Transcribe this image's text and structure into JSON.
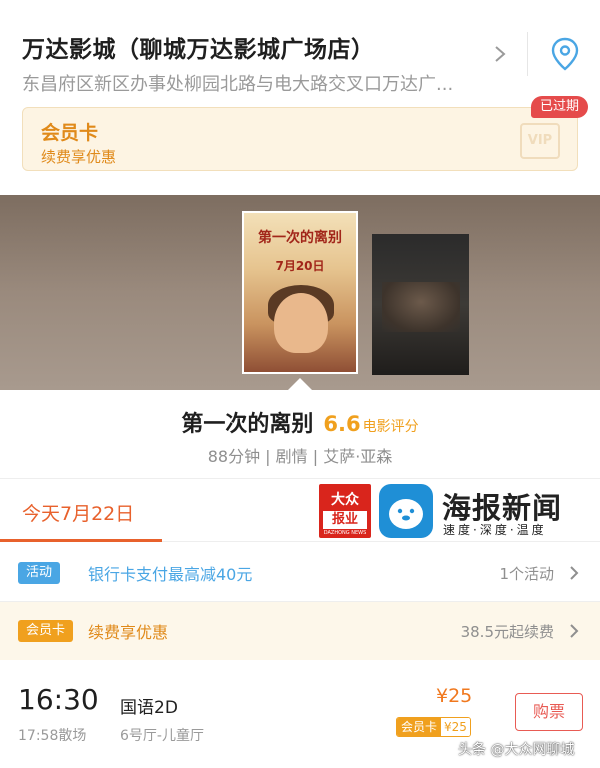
{
  "header": {
    "cinema_name": "万达影城（聊城万达影城广场店）",
    "address": "东昌府区新区办事处柳园北路与电大路交叉口万达广..."
  },
  "member_card": {
    "title": "会员卡",
    "subtitle": "续费享优惠",
    "vip_text": "VIP",
    "expired_badge": "已过期"
  },
  "movie": {
    "title": "第一次的离别",
    "rating": "6.6",
    "rating_label": "电影评分",
    "meta": "88分钟 | 剧情 | 艾萨·亚森",
    "poster_title": "第一次的离别",
    "poster_date": "7月20日"
  },
  "date_tabs": {
    "today": "今天7月22日"
  },
  "logos": {
    "dazhong_top": "大众",
    "dazhong_bottom": "报业",
    "dazhong_small": "DAZHONG NEWS",
    "haibao": "海报新闻",
    "haibao_sub": "速度·深度·温度"
  },
  "activity_row": {
    "tag": "活动",
    "text": "银行卡支付最高减40元",
    "right": "1个活动"
  },
  "member_row": {
    "tag": "会员卡",
    "text": "续费享优惠",
    "right": "38.5元起续费"
  },
  "showtime": {
    "start": "16:30",
    "end": "17:58散场",
    "language": "国语2D",
    "hall": "6号厅-儿童厅",
    "price": "¥25",
    "member_label": "会员卡",
    "member_price": "¥25",
    "buy_label": "购票"
  },
  "watermark": "头条 @大众网聊城",
  "colors": {
    "accent_orange": "#e8612c",
    "rating_yellow": "#f0a01e",
    "activity_blue": "#4aa6e4",
    "buy_red": "#e85b54",
    "expired_red": "#e54b4b"
  },
  "icons": {
    "detail": "chevron-right-icon",
    "location": "location-pin-icon",
    "row_arrow": "chevron-right-icon"
  }
}
